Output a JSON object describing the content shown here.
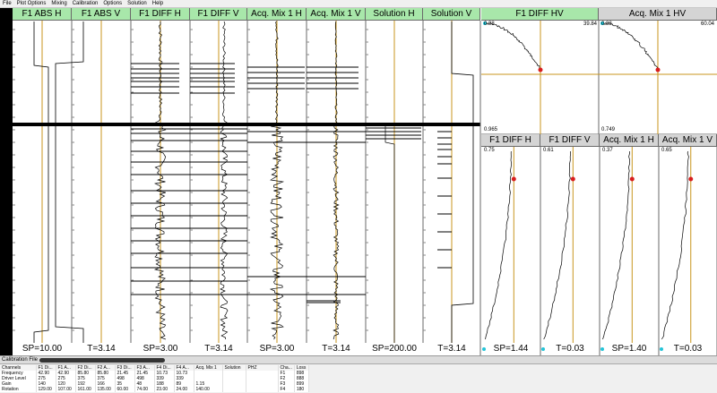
{
  "menu": [
    "File",
    "Plot Options",
    "Mixing",
    "Calibration",
    "Options",
    "Solution",
    "Help"
  ],
  "strip_channels": [
    {
      "header": "F1  ABS H",
      "footer": "SP=10.00"
    },
    {
      "header": "F1  ABS V",
      "footer": "T=3.14"
    },
    {
      "header": "F1 DIFF H",
      "footer": "SP=3.00"
    },
    {
      "header": "F1 DIFF V",
      "footer": "T=3.14"
    },
    {
      "header": "Acq. Mix 1 H",
      "footer": "SP=3.00"
    },
    {
      "header": "Acq. Mix 1 V",
      "footer": "T=3.14"
    },
    {
      "header": "Solution H",
      "footer": "SP=200.00"
    },
    {
      "header": "Solution V",
      "footer": "T=3.14"
    }
  ],
  "lissajous": [
    {
      "header": "F1 DIFF HV",
      "top_left": "0.98",
      "top_right": "39.84",
      "bottom_left": "0.965"
    },
    {
      "header": "Acq. Mix 1 HV",
      "top_left": "0.88",
      "top_right": "60.04",
      "bottom_left": "0.749"
    }
  ],
  "vert_channels": [
    {
      "header": "F1 DIFF H",
      "value": "0.75"
    },
    {
      "header": "F1 DIFF V",
      "value": "0.61"
    },
    {
      "header": "Acq. Mix 1 H",
      "value": "0.37"
    },
    {
      "header": "Acq. Mix 1 V",
      "value": "0.65"
    }
  ],
  "vert_footers": [
    "SP=1.44",
    "T=0.03",
    "SP=1.40",
    "T=0.03"
  ],
  "calibration": {
    "title": "Calibration File",
    "header": [
      "Channels",
      "F1 Di...",
      "F1 A...",
      "F2 Di...",
      "F2 A...",
      "F3 Di...",
      "F3 A...",
      "F4 Di...",
      "F4 A...",
      "Acq. Mix 1",
      "Solution",
      "PHZ",
      "Cha...",
      "Loss"
    ],
    "rows": [
      [
        "Frequency",
        "42.90",
        "42.90",
        "85.80",
        "85.80",
        "21.45",
        "21.45",
        "10.73",
        "10.73",
        "",
        "",
        "",
        "F1",
        "898"
      ],
      [
        "Driver Level",
        "275",
        "275",
        "375",
        "375",
        "498",
        "498",
        "339",
        "339",
        "",
        "",
        "",
        "F2",
        "888"
      ],
      [
        "Gain",
        "140",
        "120",
        "192",
        "166",
        "35",
        "48",
        "188",
        "89",
        "1.15",
        "",
        "",
        "F3",
        "899"
      ],
      [
        "Rotation",
        "129.00",
        "107.00",
        "161.00",
        "135.00",
        "60.00",
        "74.00",
        "23.00",
        "24.00",
        "140.00",
        "",
        "",
        "F4",
        "180"
      ]
    ]
  },
  "colors": {
    "header_green": "#a8e7aa",
    "header_gray": "#d4d4d4",
    "dot": "#d81e1e",
    "cursor": "#c8961e"
  }
}
